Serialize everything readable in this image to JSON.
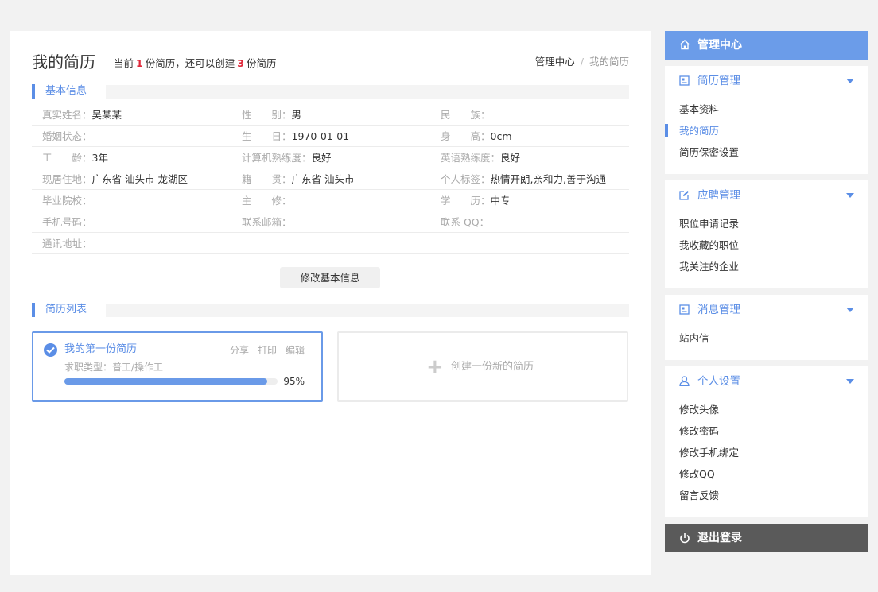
{
  "header": {
    "title": "我的简历",
    "info_prefix": "当前",
    "current_count": "1",
    "info_middle": "份简历，还可以创建",
    "remaining_count": "3",
    "info_suffix": "份简历"
  },
  "breadcrumb": {
    "home": "管理中心",
    "separator": "/",
    "current": "我的简历"
  },
  "basic_section": {
    "title": "基本信息"
  },
  "basic_info": {
    "rows": [
      [
        {
          "k": "真实姓名：",
          "v": "吴某某"
        },
        {
          "k": "性　　别：",
          "v": "男"
        },
        {
          "k": "民　　族：",
          "v": ""
        }
      ],
      [
        {
          "k": "婚姻状态：",
          "v": ""
        },
        {
          "k": "生　　日：",
          "v": "1970-01-01"
        },
        {
          "k": "身　　高：",
          "v": "0cm"
        }
      ],
      [
        {
          "k": "工　　龄：",
          "v": "3年"
        },
        {
          "k": "计算机熟练度：",
          "v": "良好"
        },
        {
          "k": "英语熟练度：",
          "v": "良好"
        }
      ],
      [
        {
          "k": "现居住地：",
          "v": "广东省 汕头市 龙湖区"
        },
        {
          "k": "籍　　贯：",
          "v": "广东省 汕头市"
        },
        {
          "k": "个人标签：",
          "v": "热情开朗,亲和力,善于沟通"
        }
      ],
      [
        {
          "k": "毕业院校：",
          "v": ""
        },
        {
          "k": "主　　修：",
          "v": ""
        },
        {
          "k": "学　　历：",
          "v": "中专"
        }
      ],
      [
        {
          "k": "手机号码：",
          "v": ""
        },
        {
          "k": "联系邮箱：",
          "v": ""
        },
        {
          "k": "联系 QQ：",
          "v": ""
        }
      ],
      [
        {
          "k": "通讯地址：",
          "v": ""
        },
        {
          "k": "",
          "v": ""
        },
        {
          "k": "",
          "v": ""
        }
      ]
    ]
  },
  "edit_button": "修改基本信息",
  "resume_section": {
    "title": "简历列表"
  },
  "resume_card": {
    "name": "我的第一份简历",
    "actions": [
      "分享",
      "打印",
      "编辑"
    ],
    "job_type": "求职类型：普工/操作工",
    "progress": 0.95,
    "progress_text": "95%"
  },
  "create_card": {
    "plus": "+",
    "label": "创建一份新的简历"
  },
  "sidebar": {
    "header": "管理中心",
    "groups": [
      {
        "title": "简历管理",
        "icon": "resume-icon",
        "items": [
          "基本资料",
          "我的简历",
          "简历保密设置"
        ],
        "active": 1
      },
      {
        "title": "应聘管理",
        "icon": "apply-icon",
        "items": [
          "职位申请记录",
          "我收藏的职位",
          "我关注的企业"
        ],
        "active": -1
      },
      {
        "title": "消息管理",
        "icon": "message-icon",
        "items": [
          "站内信"
        ],
        "active": -1
      },
      {
        "title": "个人设置",
        "icon": "user-icon",
        "items": [
          "修改头像",
          "修改密码",
          "修改手机绑定",
          "修改QQ",
          "留言反馈"
        ],
        "active": -1
      }
    ],
    "logout": "退出登录"
  },
  "colors": {
    "accent": "#5b8ee6",
    "header_bg": "#6b9ce9",
    "highlight": "#e0283a",
    "logout_bg": "#5a5a5a"
  }
}
